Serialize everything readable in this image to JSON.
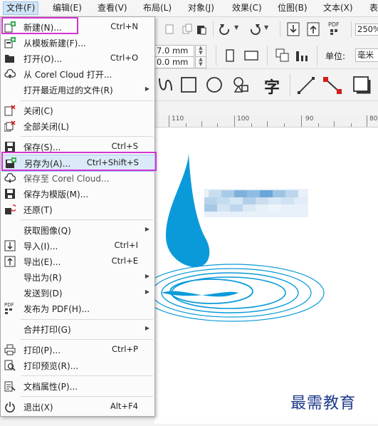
{
  "menubar": {
    "items": [
      "文件(F)",
      "编辑(E)",
      "查看(V)",
      "布局(L)",
      "对象(J)",
      "效果(C)",
      "位图(B)",
      "文本(X)",
      "表"
    ]
  },
  "file_menu": {
    "items": [
      {
        "label": "新建(N)...",
        "shortcut": "Ctrl+N",
        "icon": "new-document-icon"
      },
      {
        "label": "从模板新建(F)...",
        "shortcut": "",
        "icon": "template-icon"
      },
      {
        "label": "打开(O)...",
        "shortcut": "Ctrl+O",
        "icon": "open-folder-icon"
      },
      {
        "label": "从 Corel Cloud 打开...",
        "shortcut": "",
        "icon": "cloud-open-icon"
      },
      {
        "label": "打开最近用过的文件(R)",
        "shortcut": "",
        "submenu": true
      },
      {
        "label": "关闭(C)",
        "shortcut": "",
        "icon": "close-document-icon"
      },
      {
        "label": "全部关闭(L)",
        "shortcut": "",
        "icon": "close-all-icon"
      },
      {
        "label": "保存(S)...",
        "shortcut": "Ctrl+S",
        "icon": "save-icon"
      },
      {
        "label": "另存为(A)...",
        "shortcut": "Ctrl+Shift+S",
        "icon": "save-as-icon"
      },
      {
        "label": "保存至 Corel Cloud...",
        "shortcut": "",
        "icon": "cloud-save-icon"
      },
      {
        "label": "保存为模版(M)...",
        "shortcut": "",
        "icon": "save-template-icon"
      },
      {
        "label": "还原(T)",
        "shortcut": "",
        "icon": "revert-icon"
      },
      {
        "label": "获取图像(Q)",
        "shortcut": "",
        "submenu": true
      },
      {
        "label": "导入(I)...",
        "shortcut": "Ctrl+I",
        "icon": "import-icon"
      },
      {
        "label": "导出(E)...",
        "shortcut": "Ctrl+E",
        "icon": "export-icon"
      },
      {
        "label": "导出为(R)",
        "shortcut": "",
        "submenu": true
      },
      {
        "label": "发送到(D)",
        "shortcut": "",
        "submenu": true
      },
      {
        "label": "发布为 PDF(H)...",
        "shortcut": "",
        "icon": "pdf-icon"
      },
      {
        "label": "合并打印(G)",
        "shortcut": "",
        "submenu": true
      },
      {
        "label": "打印(P)...",
        "shortcut": "Ctrl+P",
        "icon": "print-icon"
      },
      {
        "label": "打印预览(R)...",
        "shortcut": "",
        "icon": "print-preview-icon"
      },
      {
        "label": "文档属性(P)...",
        "shortcut": "",
        "icon": "document-properties-icon"
      },
      {
        "label": "退出(X)",
        "shortcut": "Alt+F4",
        "icon": "exit-icon"
      }
    ]
  },
  "toolbar": {
    "zoom": "250%",
    "width_value": "7.0 mm",
    "height_value": "0.0 mm",
    "unit_label": "单位:",
    "unit_value": "毫米",
    "pdf_label": "PDF",
    "text_tool": "字"
  },
  "ruler": {
    "labels": [
      "110",
      "100",
      "90",
      "80"
    ]
  },
  "watermark": "最需教育",
  "colors": {
    "accent_highlight": "#d334d0",
    "drop_blue": "#0b9ad9",
    "selection_blue": "#dbeaf8"
  }
}
